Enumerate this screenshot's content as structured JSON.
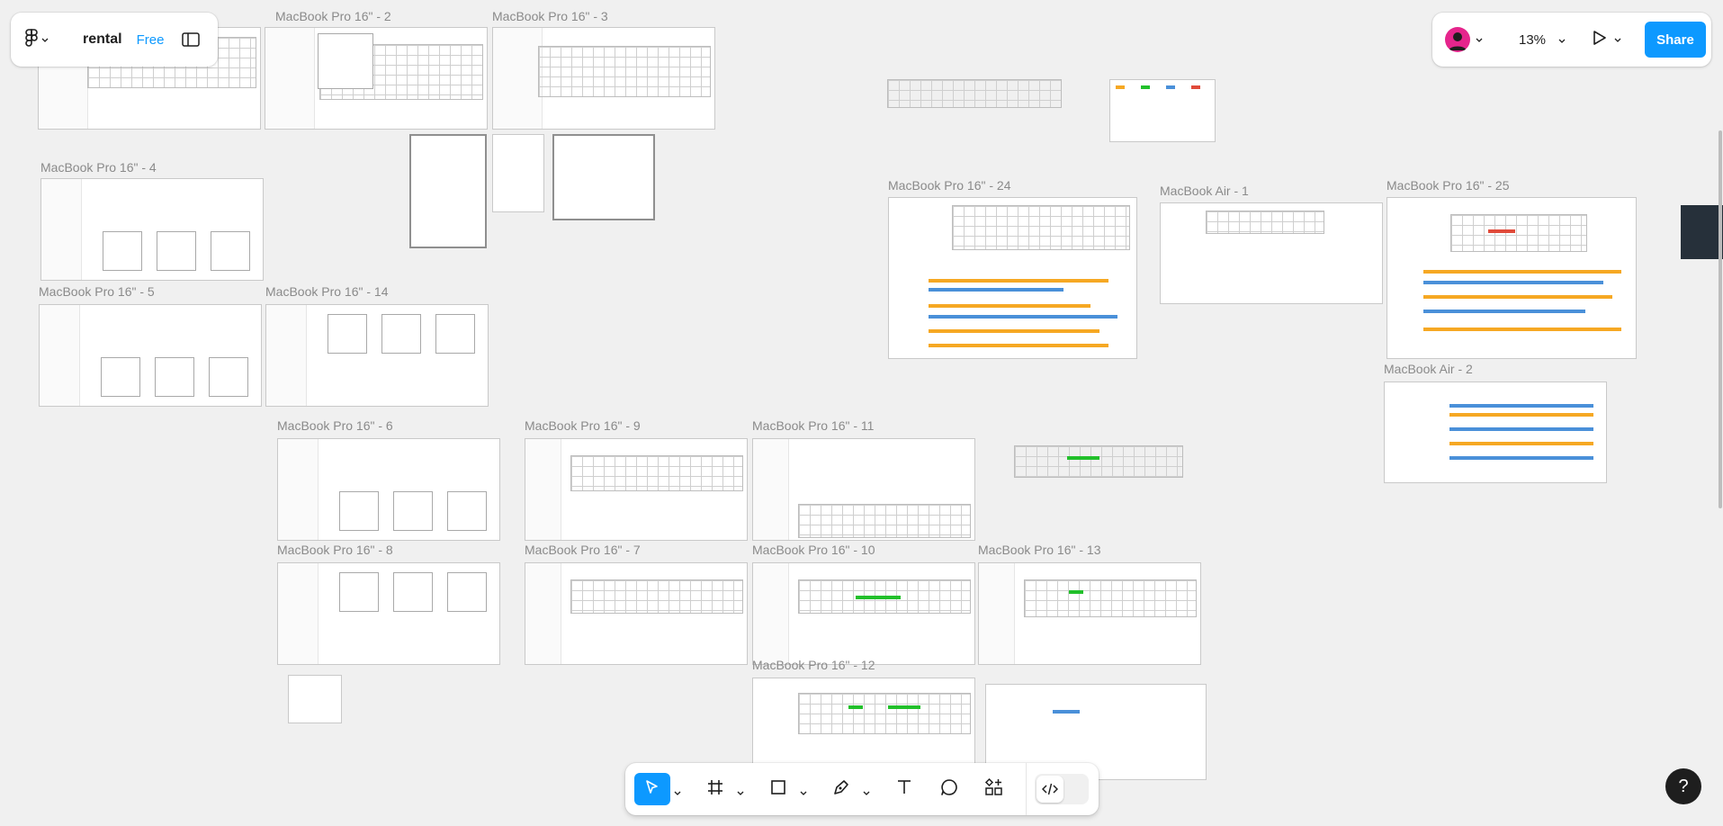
{
  "file": {
    "name": "rental",
    "plan": "Free"
  },
  "header": {
    "zoom": "13%",
    "share_label": "Share",
    "avatar_color": "#e5258c",
    "accent": "#0d99ff"
  },
  "frames": [
    "MacBook Pro 16\" - 2",
    "MacBook Pro 16\" - 3",
    "MacBook Pro 16\" - 4",
    "MacBook Pro 16\" - 5",
    "MacBook Pro 16\" - 14",
    "MacBook Pro 16\" - 24",
    "MacBook Air - 1",
    "MacBook Pro 16\" - 25",
    "MacBook Air - 2",
    "MacBook Pro 16\" - 6",
    "MacBook Pro 16\" - 9",
    "MacBook Pro 16\" - 11",
    "MacBook Pro 16\" - 8",
    "MacBook Pro 16\" - 7",
    "MacBook Pro 16\" - 10",
    "MacBook Pro 16\" - 13",
    "MacBook Pro 16\" - 12"
  ],
  "toolbar": {
    "tools": [
      "move-tool",
      "frame-tool",
      "shape-tool",
      "pen-tool",
      "text-tool",
      "comment-tool",
      "actions-tool"
    ],
    "active_tool": "move-tool",
    "dev_mode_icon": "code-icon"
  },
  "help_label": "?",
  "icons": {
    "logo": "figma-logo-icon",
    "sidebar": "sidebar-toggle-icon",
    "present": "play-icon",
    "chevron": "chevron-down-icon"
  }
}
